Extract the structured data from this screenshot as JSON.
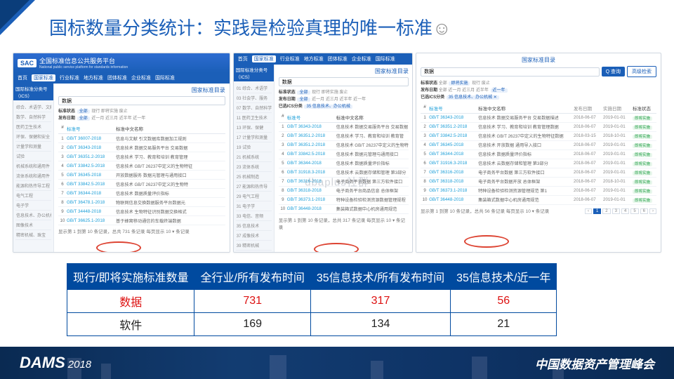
{
  "title": "国标数量分类统计：实践是检验真理的唯一标准",
  "smile": "☺",
  "platform": {
    "logo": "SAC",
    "name": "全国标准信息公共服务平台",
    "name_en": "National public service platform for standards information",
    "nav": [
      "首页",
      "国家标准",
      "行业标准",
      "地方标准",
      "团体标准",
      "企业标准",
      "国际标准"
    ],
    "side_head": "国际标准分类号（ICS）",
    "side1": [
      "综合、术语学、文献",
      "数学、自然科学",
      "医药卫生技术",
      "环保、保健和安全",
      "计量学和测量",
      "试验",
      "机械系统和通用件",
      "流体系统和通用件",
      "能源和热传导工程",
      "电气工程",
      "电子学",
      "信息技术、办公机械",
      "图像技术",
      "精密机械、珠宝"
    ],
    "side2": [
      "01 综合、术语学",
      "03 社会学、服务",
      "07 数学、自然科学",
      "11 医药卫生技术",
      "13 环保、保健",
      "17 计量学和测量",
      "19 试验",
      "21 机械系统",
      "23 流体系统",
      "25 机械制造",
      "27 能源和热传导",
      "29 电气工程",
      "31 电子学",
      "33 电信、音频",
      "35 信息技术",
      "37 成像技术",
      "39 精密机械"
    ],
    "crumb": "国家标准目录",
    "search_ph": "数据",
    "btn_search": "Q 查询",
    "btn_senior": "高级检索",
    "filters": {
      "status_label": "标准状态",
      "status": [
        "全部",
        "现行",
        "即将实施",
        "废止"
      ],
      "issue_label": "发布日期",
      "issue": [
        "全部",
        "近一月",
        "近三月",
        "近半年",
        "近一年"
      ],
      "ics_label": "已选ICS分类"
    },
    "thead": [
      "#",
      "标准号",
      "标准中文名称",
      "发布日期",
      "实施日期",
      "标准状态"
    ],
    "rows1": [
      {
        "n": "1",
        "id": "GB/T 36007-2018",
        "nm": "信息与文献 引文数据库数据加工规则"
      },
      {
        "n": "2",
        "id": "GB/T 36343-2018",
        "nm": "信息技术 数据交易服务平台 交易数据"
      },
      {
        "n": "3",
        "id": "GB/T 36351.2-2018",
        "nm": "信息技术 学习、教育和培训 教育管理"
      },
      {
        "n": "4",
        "id": "GB/T 33842.5-2018",
        "nm": "信息技术 GB/T 26237中定义的生物特征"
      },
      {
        "n": "5",
        "id": "GB/T 36345-2018",
        "nm": "开放数据服务 数据元管理与通用接口"
      },
      {
        "n": "6",
        "id": "GB/T 33842.5-2018",
        "nm": "信息技术 GB/T 26237中定义的生物特"
      },
      {
        "n": "7",
        "id": "GB/T 36344-2018",
        "nm": "信息技术 数据质量评价指标"
      },
      {
        "n": "8",
        "id": "GB/T 36478.1-2018",
        "nm": "物联网信息交换数据服务平台数据元"
      },
      {
        "n": "9",
        "id": "GB/T 34448-2018",
        "nm": "信息技术 生物特征识别数据交换格式"
      },
      {
        "n": "10",
        "id": "GB/T 36625.1-2018",
        "nm": "基于蜂窝移动通信的车载终端数据"
      }
    ],
    "rows2": [
      {
        "n": "1",
        "id": "GB/T 36343-2018",
        "nm": "信息技术 数据交易服务平台 交易数据"
      },
      {
        "n": "2",
        "id": "GB/T 36351.2-2018",
        "nm": "信息技术 学习、教育和培训 教育管"
      },
      {
        "n": "3",
        "id": "GB/T 36351.2-2018",
        "nm": "信息技术 GB/T 26237中定义的生物特"
      },
      {
        "n": "4",
        "id": "GB/T 33842.5-2018",
        "nm": "信息技术 数据元管理与通用接口"
      },
      {
        "n": "5",
        "id": "GB/T 36344-2018",
        "nm": "信息技术 数据质量评价指标"
      },
      {
        "n": "6",
        "id": "GB/T 31918.3-2018",
        "nm": "信息技术 云数据存储和管理 第3部分"
      },
      {
        "n": "7",
        "id": "GB/T 36316-2018",
        "nm": "电子商务平台数据 第三方软件接口"
      },
      {
        "n": "8",
        "id": "GB/T 36318-2018",
        "nm": "电子商务平台商品信息 总体框架"
      },
      {
        "n": "9",
        "id": "GB/T 36373.1-2018",
        "nm": "特种设备检验检测资源数据管理规程"
      },
      {
        "n": "10",
        "id": "GB/T 36448-2018",
        "nm": "集装箱式数据中心机房通用规范"
      }
    ],
    "rows3": [
      {
        "n": "1",
        "id": "GB/T 36343-2018",
        "nm": "信息技术 数据交易服务平台 交易数据描述",
        "d1": "2018-06-07",
        "d2": "2019-01-01"
      },
      {
        "n": "2",
        "id": "GB/T 36351.2-2018",
        "nm": "信息技术 学习、教育和培训 教育管理数据",
        "d1": "2018-06-07",
        "d2": "2019-01-01"
      },
      {
        "n": "3",
        "id": "GB/T 33842.5-2018",
        "nm": "信息技术 GB/T 26237中定义的生物特征数据",
        "d1": "2018-03-15",
        "d2": "2018-10-01"
      },
      {
        "n": "4",
        "id": "GB/T 36345-2018",
        "nm": "信息技术 开放数据 通用导入接口",
        "d1": "2018-06-07",
        "d2": "2019-01-01"
      },
      {
        "n": "5",
        "id": "GB/T 36344-2018",
        "nm": "信息技术 数据质量评价指标",
        "d1": "2018-06-07",
        "d2": "2019-01-01"
      },
      {
        "n": "6",
        "id": "GB/T 31916.3-2018",
        "nm": "信息技术 云数据存储和管理 第3部分",
        "d1": "2018-06-07",
        "d2": "2019-01-01"
      },
      {
        "n": "7",
        "id": "GB/T 36316-2018",
        "nm": "电子商务平台数据 第三方软件接口",
        "d1": "2018-06-07",
        "d2": "2019-01-01"
      },
      {
        "n": "8",
        "id": "GB/T 36318-2018",
        "nm": "电子商务平台数据开放 总体框架",
        "d1": "2018-06-07",
        "d2": "2018-10-01"
      },
      {
        "n": "9",
        "id": "GB/T 36373.1-2018",
        "nm": "特种设备检验检测资源管理规范 第1",
        "d1": "2018-06-07",
        "d2": "2019-01-01"
      },
      {
        "n": "10",
        "id": "GB/T 36448-2018",
        "nm": "集装箱式数据中心机房通用规范",
        "d1": "2018-06-07",
        "d2": "2019-01-01"
      }
    ],
    "foot1": "显示第 1 到第 10 条记录，总共 731 条记录 每页显示  10 ▾  条记录",
    "foot2": "显示第 1 到第 10 条记录，总共 317 条记录 每页显示  10 ▾  条记录",
    "foot3": "显示第 1 到第 10 条记录，总共 56 条记录 每页显示  10 ▾  条记录",
    "status_badge": "即将实施"
  },
  "summary": {
    "head": [
      "现行/即将实施标准数量",
      "全行业/所有发布时间",
      "35信息技术/所有发布时间",
      "35信息技术/近一年"
    ],
    "rows": [
      {
        "label": "数据",
        "v": [
          "731",
          "317",
          "56"
        ],
        "hot": true
      },
      {
        "label": "软件",
        "v": [
          "169",
          "134",
          "21"
        ],
        "hot": false
      }
    ]
  },
  "footer": {
    "brand": "DAMS",
    "year": "2018",
    "conf": "中国数据资产管理峰会"
  },
  "watermark": "dbaplus社群"
}
